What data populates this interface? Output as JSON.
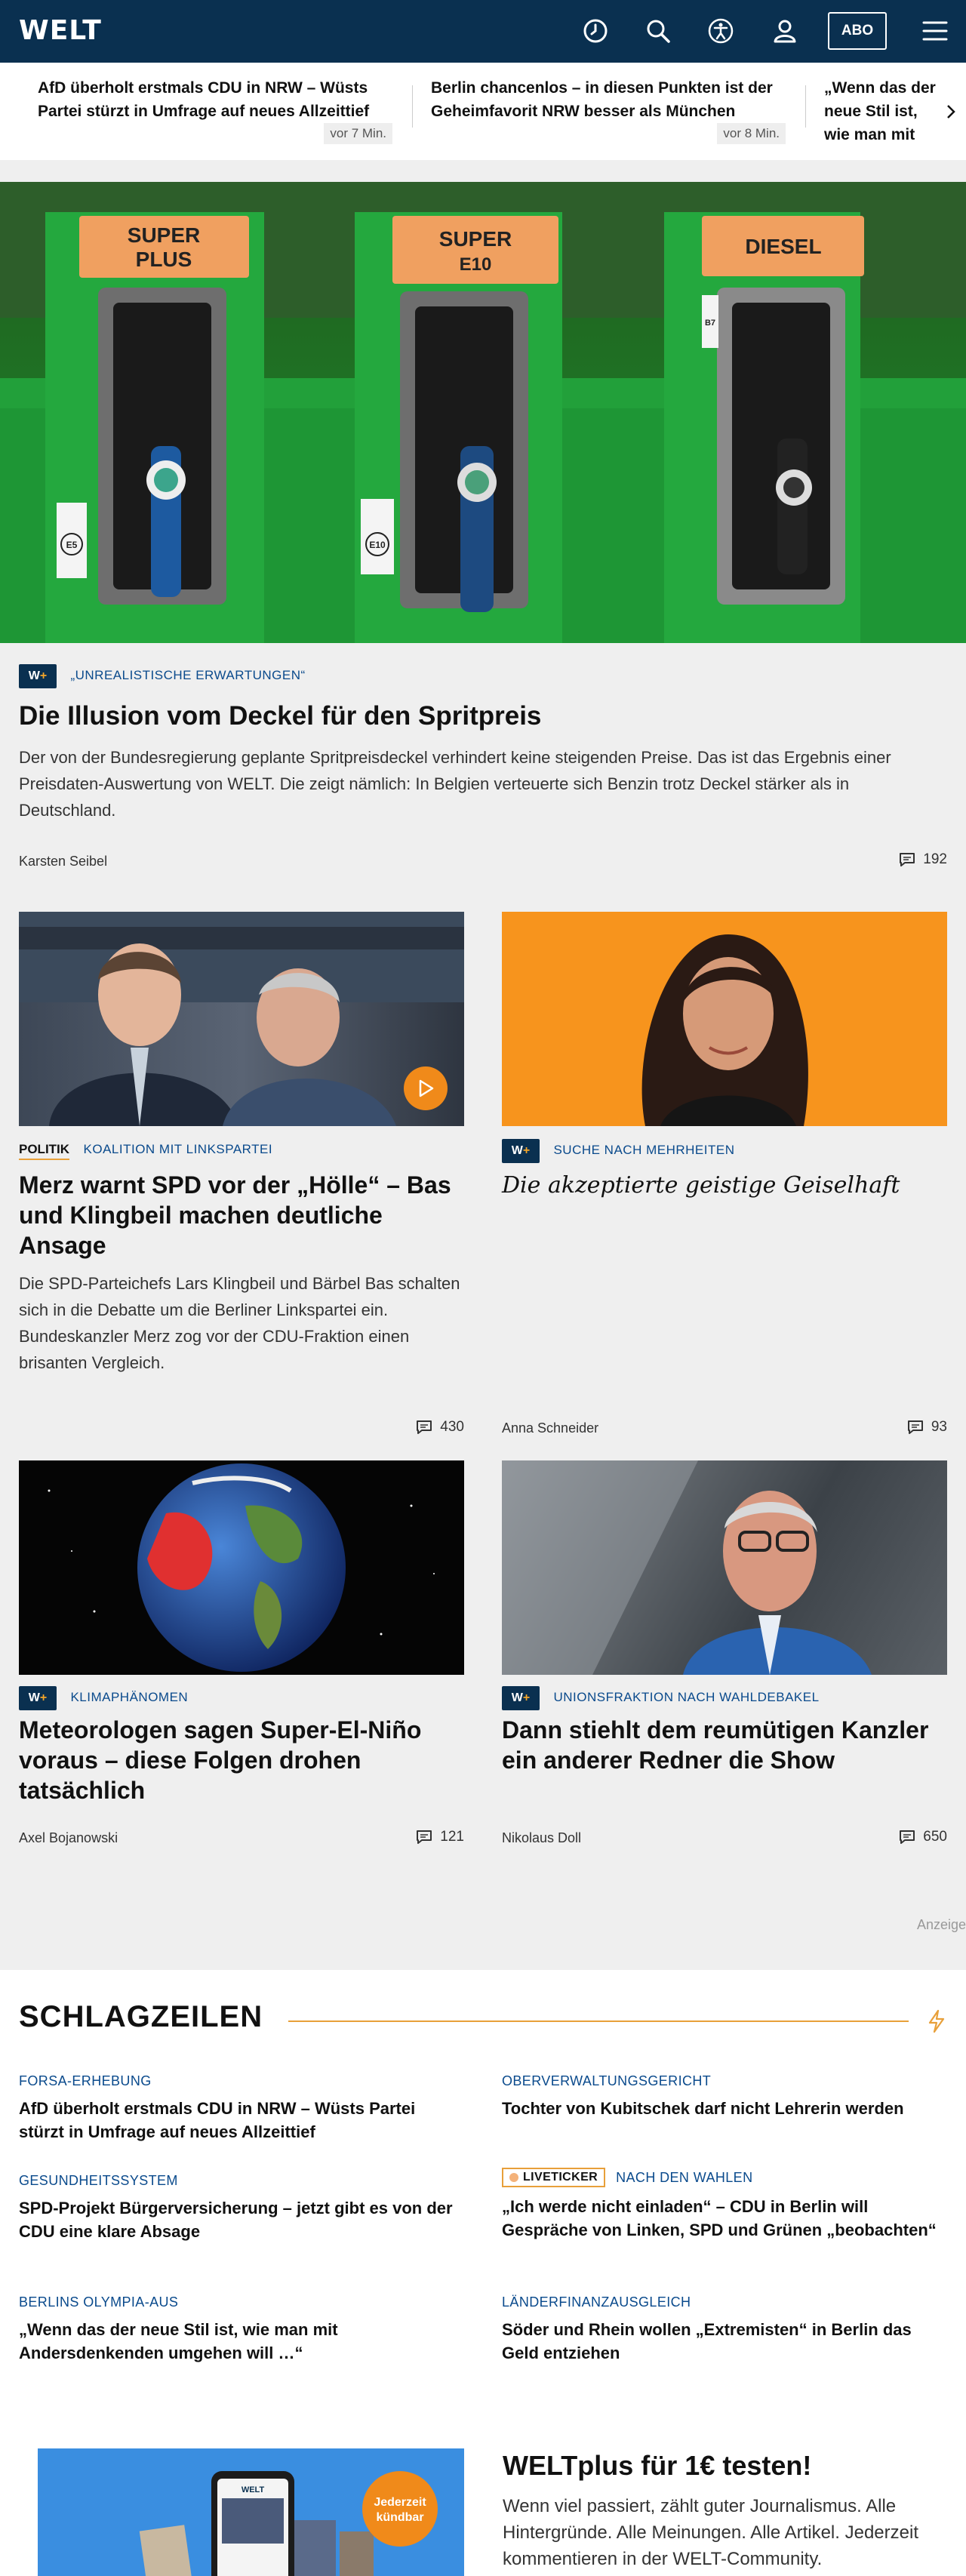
{
  "header": {
    "logo": "WELT",
    "abo_label": "ABO",
    "icons": [
      "clock-icon",
      "search-icon",
      "accessibility-icon",
      "user-icon",
      "menu-icon"
    ]
  },
  "ticker": [
    {
      "title": "AfD überholt erstmals CDU in NRW – Wüsts Partei stürzt in Umfrage auf neues Allzeittief",
      "time": "vor 7 Min."
    },
    {
      "title": "Berlin chancenlos – in diesen Punkten ist der Geheimfavorit NRW besser als München",
      "time": "vor 8 Min."
    },
    {
      "title": "„Wenn das der neue Stil ist, wie man mit Andersdenkenden umgehen will …“",
      "time": ""
    }
  ],
  "hero": {
    "pumps": [
      "SUPER PLUS",
      "SUPER E10",
      "DIESEL"
    ],
    "pump_lines": [
      [
        "SUPER",
        "PLUS"
      ],
      [
        "SUPER",
        "E10"
      ],
      [
        "DIESEL"
      ]
    ],
    "pump_badges": [
      "E5",
      "E10",
      "B7"
    ],
    "kicker": "„UNREALISTISCHE ERWARTUNGEN“",
    "title": "Die Illusion vom Deckel für den Spritpreis",
    "lede": "Der von der Bundesregierung geplante Spritpreisdeckel verhindert keine steigenden Preise. Das ist das Ergebnis einer Preisdaten-Auswertung von WELT. Die zeigt nämlich: In Belgien verteuerte sich Benzin trotz Deckel stärker als in Deutschland.",
    "author": "Karsten Seibel",
    "comments": "192"
  },
  "wplus_label": {
    "w": "W",
    "plus": "+"
  },
  "articles": [
    {
      "section": "POLITIK",
      "kicker": "KOALITION MIT LINKSPARTEI",
      "title": "Merz warnt SPD vor der „Hölle“ – Bas und Klingbeil machen deutliche Ansage",
      "lede": "Die SPD-Parteichefs Lars Klingbeil und Bärbel Bas schalten sich in die Debatte um die Berliner Linkspartei ein. Bundeskanzler Merz zog vor der CDU-Fraktion einen brisanten Vergleich.",
      "author": "",
      "comments": "430"
    },
    {
      "kicker": "SUCHE NACH MEHRHEITEN",
      "title": "Die akzeptierte geistige Geiselhaft",
      "author": "Anna Schneider",
      "comments": "93"
    },
    {
      "kicker": "KLIMAPHÄNOMEN",
      "title": "Meteorologen sagen Super-El-Niño voraus – diese Folgen drohen tatsächlich",
      "author": "Axel Bojanowski",
      "comments": "121"
    },
    {
      "kicker": "UNIONSFRAKTION NACH WAHLDEBAKEL",
      "title": "Dann stiehlt dem reumütigen Kanzler ein anderer Redner die Show",
      "author": "Nikolaus Doll",
      "comments": "650"
    }
  ],
  "ad_label": "Anzeige",
  "schlagzeilen": {
    "title": "SCHLAGZEILEN",
    "items": [
      {
        "kicker": "FORSA-ERHEBUNG",
        "title": "AfD überholt erstmals CDU in NRW – Wüsts Partei stürzt in Umfrage auf neues Allzeittief"
      },
      {
        "kicker": "OBERVERWALTUNGSGERICHT",
        "title": "Tochter von Kubitschek darf nicht Lehrerin werden"
      },
      {
        "kicker": "GESUNDHEITSSYSTEM",
        "title": "SPD-Projekt Bürgerversicherung – jetzt gibt es von der CDU eine klare Absage"
      },
      {
        "badge": "LIVETICKER",
        "kicker": "NACH DEN WAHLEN",
        "title": "„Ich werde nicht einladen“ – CDU in Berlin will Gespräche von Linken, SPD und Grünen „beobachten“"
      },
      {
        "kicker": "BERLINS OLYMPIA-AUS",
        "title": "„Wenn das der neue Stil ist, wie man mit Andersdenkenden umgehen will …“"
      },
      {
        "kicker": "LÄNDERFINANZAUSGLEICH",
        "title": "Söder und Rhein wollen „Extremisten“ in Berlin das Geld entziehen"
      }
    ]
  },
  "promo": {
    "title": "WELTplus für 1€ testen!",
    "text": "Wenn viel passiert, zählt guter Journalismus. Alle Hintergründe. Alle Meinungen. Alle Artikel. Jederzeit kommentieren in der WELT-Community.",
    "badge_lines": [
      "Jederzeit",
      "kündbar"
    ],
    "phone_logo": "WELT"
  }
}
